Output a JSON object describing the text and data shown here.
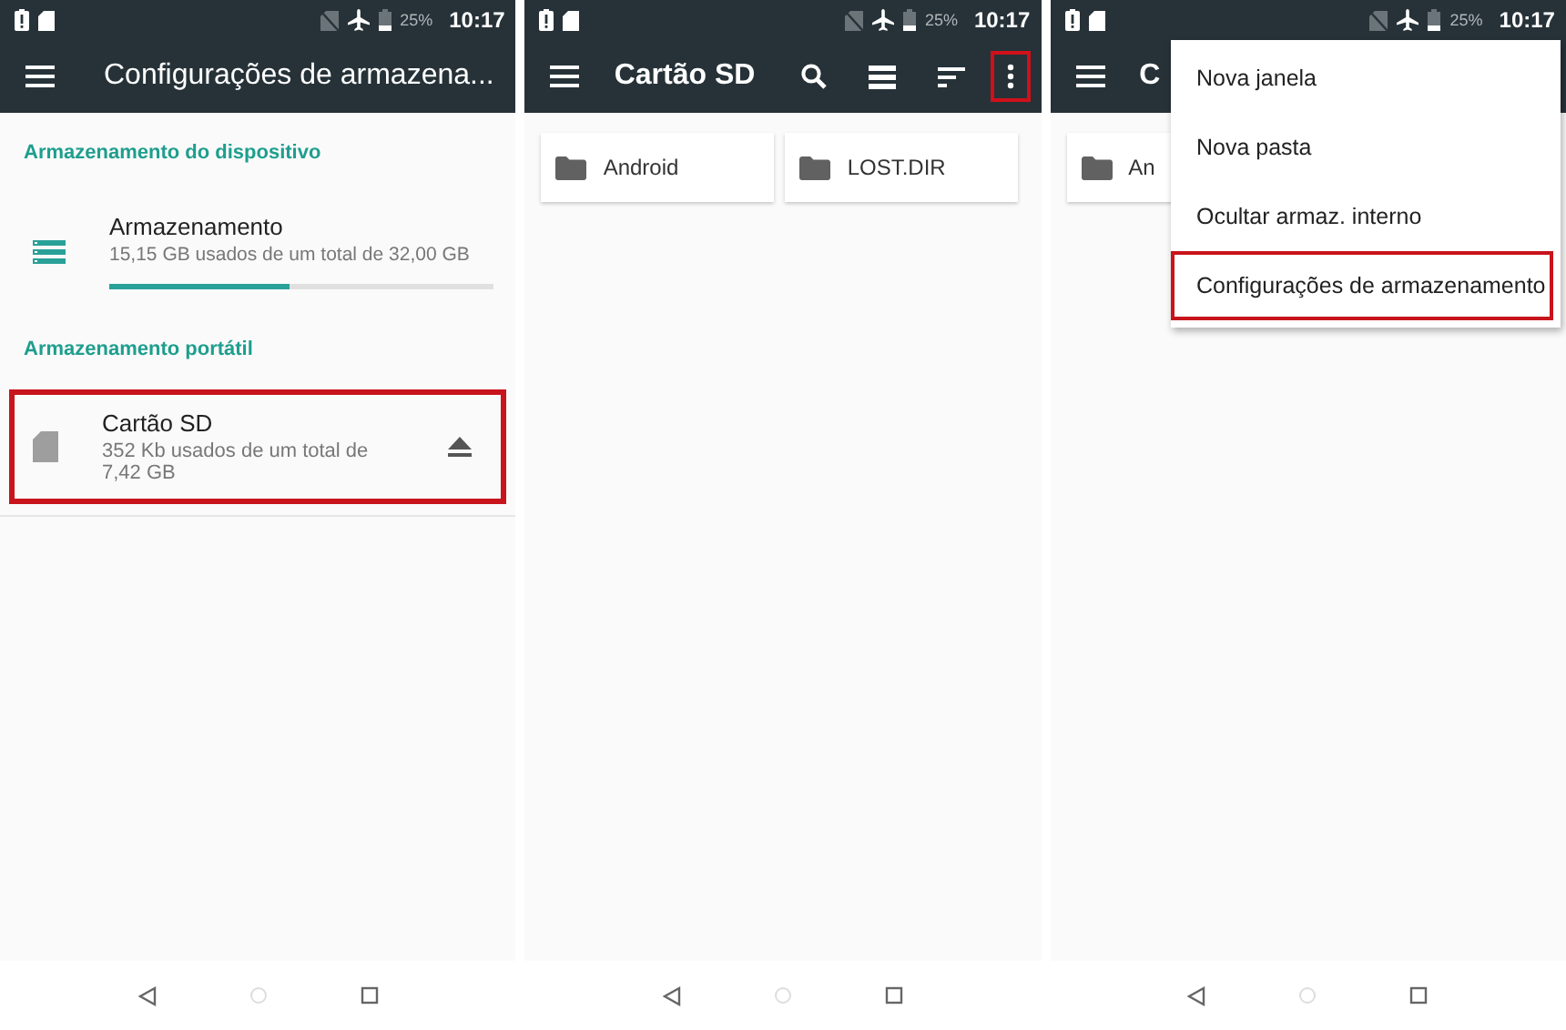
{
  "screens": [
    {
      "kind": "settings",
      "status_bar": {
        "battery": "25%",
        "time": "10:17"
      },
      "toolbar": {
        "title": "Configurações de armazena..."
      },
      "sections": [
        {
          "header": "Armazenamento do dispositivo",
          "items": [
            {
              "kind": "internal",
              "title": "Armazenamento",
              "subtitle": "15,15 GB usados de um total de 32,00 GB",
              "level": 0.47,
              "highlighted": false
            }
          ]
        },
        {
          "header": "Armazenamento portátil",
          "items": [
            {
              "kind": "sd",
              "title": "Cartão SD",
              "subtitle": "352 Kb usados de um total de 7,42 GB",
              "eject": true,
              "highlighted": true
            }
          ]
        }
      ]
    },
    {
      "kind": "browser",
      "status_bar": {
        "battery": "25%",
        "time": "10:17"
      },
      "toolbar": {
        "title": "Cartão SD",
        "actions": [
          {
            "kind": "search",
            "highlighted": false
          },
          {
            "kind": "list",
            "highlighted": false
          },
          {
            "kind": "sort",
            "highlighted": false
          },
          {
            "kind": "more",
            "highlighted": true
          }
        ]
      },
      "folders": [
        {
          "name": "Android"
        },
        {
          "name": "LOST.DIR"
        }
      ]
    },
    {
      "kind": "browser",
      "status_bar": {
        "battery": "25%",
        "time": "10:17"
      },
      "toolbar": {
        "title": "C"
      },
      "folders": [
        {
          "name": "An"
        }
      ],
      "menu": [
        {
          "label": "Nova janela",
          "highlighted": false
        },
        {
          "label": "Nova pasta",
          "highlighted": false
        },
        {
          "label": "Ocultar armaz. interno",
          "highlighted": false
        },
        {
          "label": "Configurações de armazenamento",
          "highlighted": true
        }
      ]
    }
  ]
}
